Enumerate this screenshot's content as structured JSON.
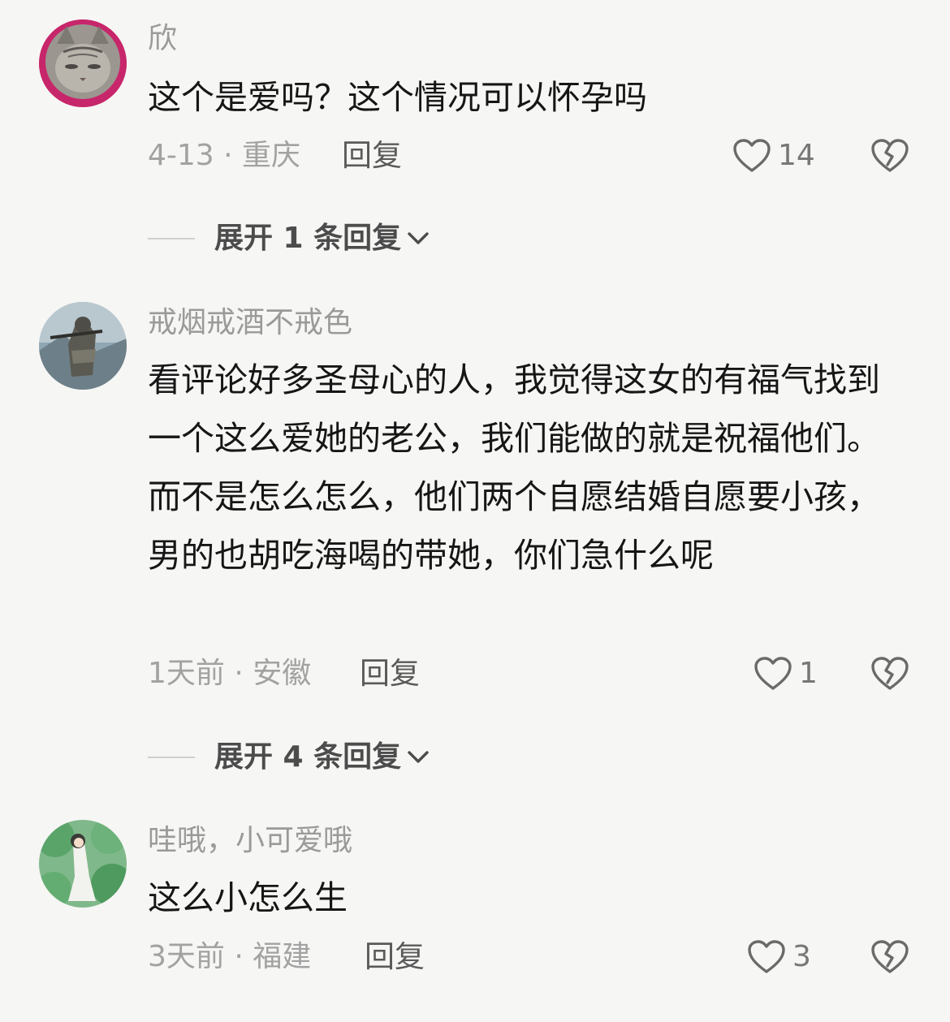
{
  "comments": [
    {
      "username": "欣",
      "body": "这个是爱吗？这个情况可以怀孕吗",
      "meta": "4-13 · 重庆",
      "reply_label": "回复",
      "likes": "14",
      "expand_label": "展开 1 条回复"
    },
    {
      "username": "戒烟戒酒不戒色",
      "body": "看评论好多圣母心的人，我觉得这女的有福气找到一个这么爱她的老公，我们能做的就是祝福他们。而不是怎么怎么，他们两个自愿结婚自愿要小孩，男的也胡吃海喝的带她，你们急什么呢",
      "meta": "1天前 · 安徽",
      "reply_label": "回复",
      "likes": "1",
      "expand_label": "展开 4 条回复"
    },
    {
      "username": "哇哦，小可爱哦",
      "body": "这么小怎么生",
      "meta": "3天前 · 福建",
      "reply_label": "回复",
      "likes": "3"
    }
  ],
  "icons": {
    "like": "heart-outline-icon",
    "dislike": "broken-heart-icon",
    "expand": "chevron-down-icon"
  },
  "colors": {
    "background": "#f6f6f4",
    "username": "#9a9a9a",
    "body": "#161616",
    "meta": "#a2a2a2"
  }
}
